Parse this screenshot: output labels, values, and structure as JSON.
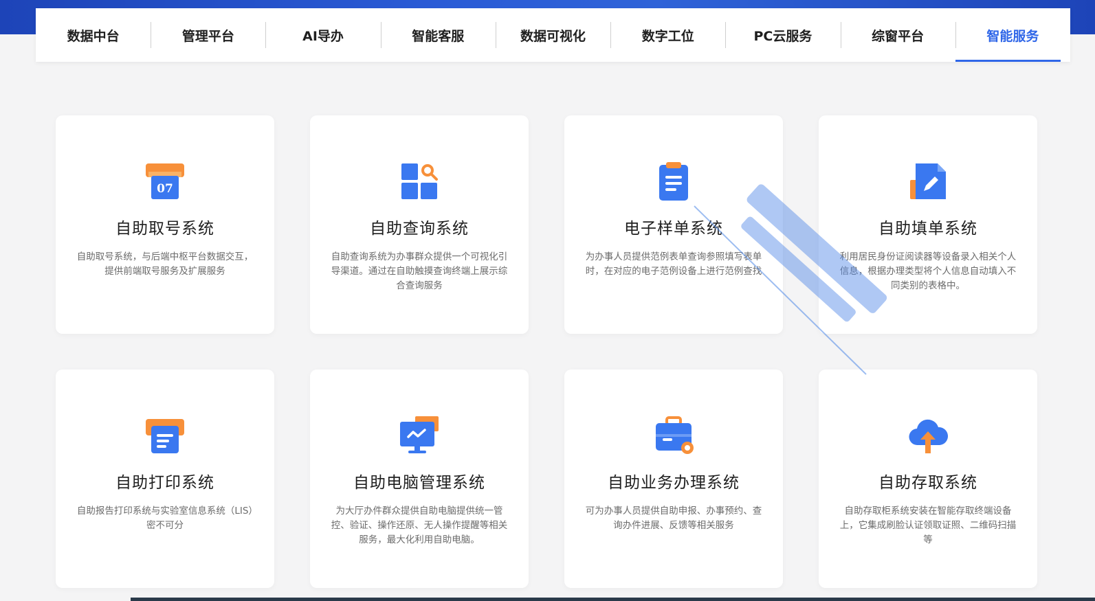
{
  "nav": {
    "tabs": [
      {
        "label": "数据中台"
      },
      {
        "label": "管理平台"
      },
      {
        "label": "AI导办"
      },
      {
        "label": "智能客服"
      },
      {
        "label": "数据可视化"
      },
      {
        "label": "数字工位"
      },
      {
        "label": "PC云服务"
      },
      {
        "label": "综窗平台"
      },
      {
        "label": "智能服务"
      }
    ],
    "active_index": 8
  },
  "cards": [
    {
      "icon": "calendar-ticket-icon",
      "icon_text": "07",
      "title": "自助取号系统",
      "desc": "自助取号系统，与后端中枢平台数据交互，提供前端取号服务及扩展服务"
    },
    {
      "icon": "grid-search-icon",
      "title": "自助查询系统",
      "desc": "自助查询系统为办事群众提供一个可视化引导渠道。通过在自助触摸查询终端上展示综合查询服务"
    },
    {
      "icon": "clipboard-icon",
      "title": "电子样单系统",
      "desc": "为办事人员提供范例表单查询参照填写表单时，在对应的电子范例设备上进行范例查找"
    },
    {
      "icon": "document-edit-icon",
      "title": "自助填单系统",
      "desc": "利用居民身份证阅读器等设备录入相关个人信息，根据办理类型将个人信息自动填入不同类别的表格中。"
    },
    {
      "icon": "printer-icon",
      "title": "自助打印系统",
      "desc": "自助报告打印系统与实验室信息系统（LIS）密不可分"
    },
    {
      "icon": "monitor-icon",
      "title": "自助电脑管理系统",
      "desc": "为大厅办件群众提供自助电脑提供统一管控、验证、操作还原、无人操作提醒等相关服务，最大化利用自助电脑。"
    },
    {
      "icon": "toolbox-gear-icon",
      "title": "自助业务办理系统",
      "desc": "可为办事人员提供自助申报、办事预约、查询办件进展、反馈等相关服务"
    },
    {
      "icon": "cloud-upload-icon",
      "title": "自助存取系统",
      "desc": "自助存取柜系统安装在智能存取终端设备上，它集成刷脸认证领取证照、二维码扫描等"
    }
  ],
  "colors": {
    "accent": "#2f66e8",
    "icon_blue": "#3a78f0",
    "icon_orange": "#f7903a"
  }
}
